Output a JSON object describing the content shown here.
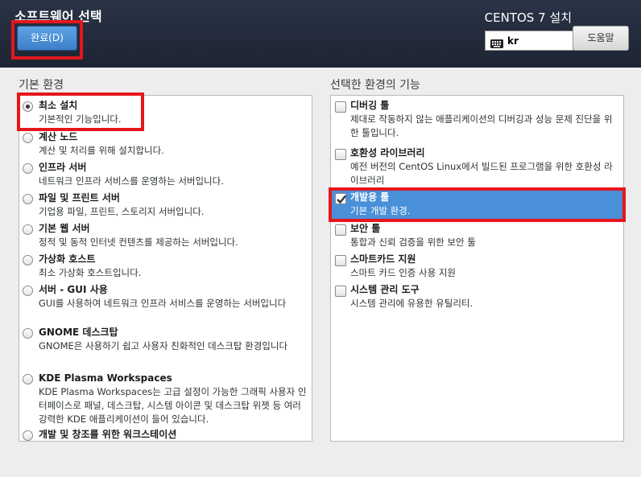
{
  "header": {
    "title": "소프트웨어 선택",
    "done_label": "완료(D)",
    "os_title": "CENTOS 7 설치",
    "keyboard_layout": "kr",
    "help_label": "도움말",
    "background_color": "#1f2737",
    "accent_color": "#4a90d9"
  },
  "base_env": {
    "heading": "기본 환경",
    "selected_index": 0,
    "items": [
      {
        "name": "최소 설치",
        "desc": "기본적인 기능입니다."
      },
      {
        "name": "계산 노드",
        "desc": "계산 및 처리를 위해 설치합니다."
      },
      {
        "name": "인프라 서버",
        "desc": "네트워크 인프라 서비스를 운영하는 서버입니다."
      },
      {
        "name": "파일 및 프린트 서버",
        "desc": "기업용 파일, 프린트, 스토리지 서버입니다."
      },
      {
        "name": "기본 웹 서버",
        "desc": "정적 및 동적 인터넷 컨텐츠를 제공하는 서버입니다."
      },
      {
        "name": "가상화 호스트",
        "desc": "최소 가상화 호스트입니다."
      },
      {
        "name": "서버 - GUI 사용",
        "desc": "GUI를 사용하여 네트워크 인프라 서비스를 운영하는 서버입니다"
      },
      {
        "name": "GNOME 데스크탑",
        "desc": "GNOME은 사용하기 쉽고 사용자 친화적인 데스크탑 환경입니다"
      },
      {
        "name": "KDE Plasma Workspaces",
        "desc": "KDE Plasma Workspaces는 고급 설정이 가능한 그래픽 사용자 인터페이스로 패널, 데스크탑, 시스템 아이콘 및 데스크탑 위젯 등 여러 강력한 KDE 애플리케이션이 들어 있습니다."
      },
      {
        "name": "개발 및 창조를 위한 워크스테이션",
        "desc": ""
      }
    ]
  },
  "addons": {
    "heading": "선택한 환경의 기능",
    "items": [
      {
        "name": "디버깅 툴",
        "desc": "제대로 작동하지 않는 애플리케이션의 디버깅과 성능 문제 진단을 위한 툴입니다.",
        "checked": false
      },
      {
        "name": "호환성 라이브러리",
        "desc": "예전 버전의 CentOS Linux에서 빌드된 프로그램을 위한 호환성 라이브러리",
        "checked": false
      },
      {
        "name": "개발용 툴",
        "desc": "기본 개발 환경.",
        "checked": true
      },
      {
        "name": "보안 툴",
        "desc": "통합과 신뢰 검증을 위한 보안 툴",
        "checked": false
      },
      {
        "name": "스마트카드 지원",
        "desc": "스마트 카드 인증 사용 지원",
        "checked": false
      },
      {
        "name": "시스템 관리 도구",
        "desc": "시스템 관리에 유용한 유틸리티.",
        "checked": false
      }
    ]
  }
}
